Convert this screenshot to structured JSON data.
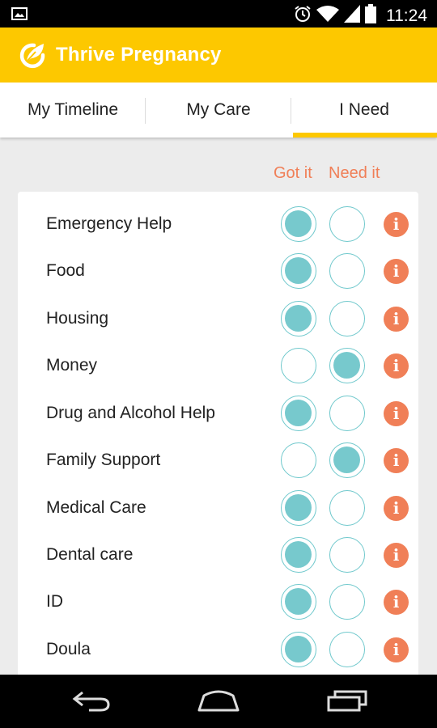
{
  "status_bar": {
    "time": "11:24",
    "icons": [
      "image-icon",
      "alarm-icon",
      "wifi-icon",
      "signal-icon",
      "battery-icon"
    ]
  },
  "app_bar": {
    "title": "Thrive Pregnancy",
    "logo_icon": "leaf-icon",
    "color": "#fdc800"
  },
  "tabs": [
    {
      "label": "My Timeline",
      "active": false
    },
    {
      "label": "My Care",
      "active": false
    },
    {
      "label": "I Need",
      "active": true
    }
  ],
  "columns": {
    "got_label": "Got it",
    "need_label": "Need it"
  },
  "items": [
    {
      "label": "Emergency Help",
      "selected": "got"
    },
    {
      "label": "Food",
      "selected": "got"
    },
    {
      "label": "Housing",
      "selected": "got"
    },
    {
      "label": "Money",
      "selected": "need"
    },
    {
      "label": "Drug and Alcohol Help",
      "selected": "got"
    },
    {
      "label": "Family Support",
      "selected": "need"
    },
    {
      "label": "Medical Care",
      "selected": "got"
    },
    {
      "label": "Dental care",
      "selected": "got"
    },
    {
      "label": "ID",
      "selected": "got"
    },
    {
      "label": "Doula",
      "selected": "got"
    }
  ],
  "info_glyph": "i",
  "colors": {
    "accent": "#fdc800",
    "column_header": "#f07f57",
    "radio": "#77c9cd",
    "info": "#f07f57"
  },
  "nav_bar": {
    "icons": [
      "back-icon",
      "home-icon",
      "recents-icon"
    ]
  }
}
